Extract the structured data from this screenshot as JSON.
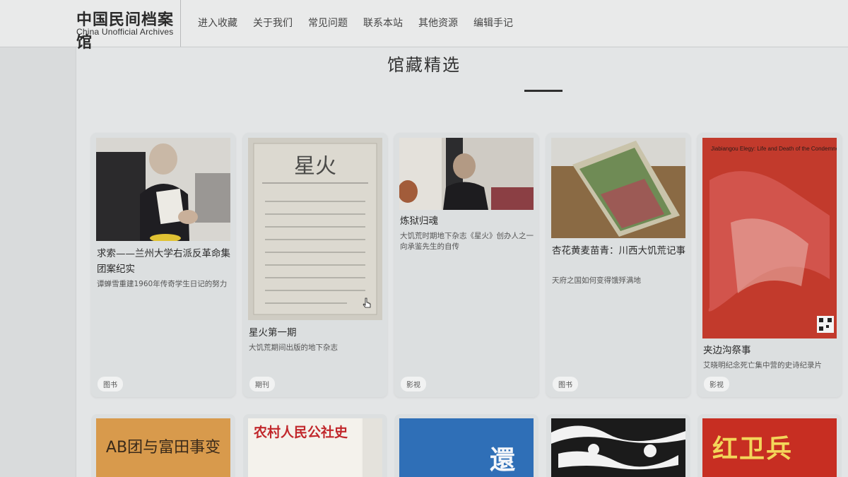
{
  "site": {
    "name_cn": "中国民间档案馆",
    "name_en": "China Unofficial Archives"
  },
  "nav": {
    "items": [
      {
        "label": "进入收藏"
      },
      {
        "label": "关于我们"
      },
      {
        "label": "常见问题"
      },
      {
        "label": "联系本站"
      },
      {
        "label": "其他资源"
      },
      {
        "label": "编辑手记"
      }
    ]
  },
  "section": {
    "title": "馆藏精选"
  },
  "cards": [
    {
      "title": "求索——兰州大学右派反革命集团案纪实",
      "desc": "谭蝉雪重建1960年传奇学生日记的努力",
      "tag": "图书"
    },
    {
      "title": "星火第一期",
      "desc": "大饥荒期间出版的地下杂志",
      "tag": "期刊",
      "thumb_text": "星火"
    },
    {
      "title": "炼狱归魂",
      "desc": "大饥荒时期地下杂志《星火》创办人之一向承鉴先生的自传",
      "tag": "影视"
    },
    {
      "title": "杏花黄麦苗青：川西大饥荒记事",
      "desc": "天府之国如何变得饿殍满地",
      "tag": "图书"
    },
    {
      "title": "夹边沟祭事",
      "desc": "艾晓明纪念死亡集中营的史诗纪录片",
      "tag": "影视",
      "thumb_text": "Jiabiangou Elegy: Life and Death of the Condemned"
    }
  ],
  "row2": [
    {
      "thumb_text": "AB团与富田事变"
    },
    {
      "thumb_text": "农村人民公社史"
    },
    {
      "thumb_text": "還"
    },
    {
      "thumb_text": ""
    },
    {
      "thumb_text": "红卫兵"
    }
  ],
  "colors": {
    "background": "#e3e5e6",
    "card": "#dcdfe0",
    "title_line": "#2f2f2f",
    "poster_red": "#c23a2c"
  }
}
